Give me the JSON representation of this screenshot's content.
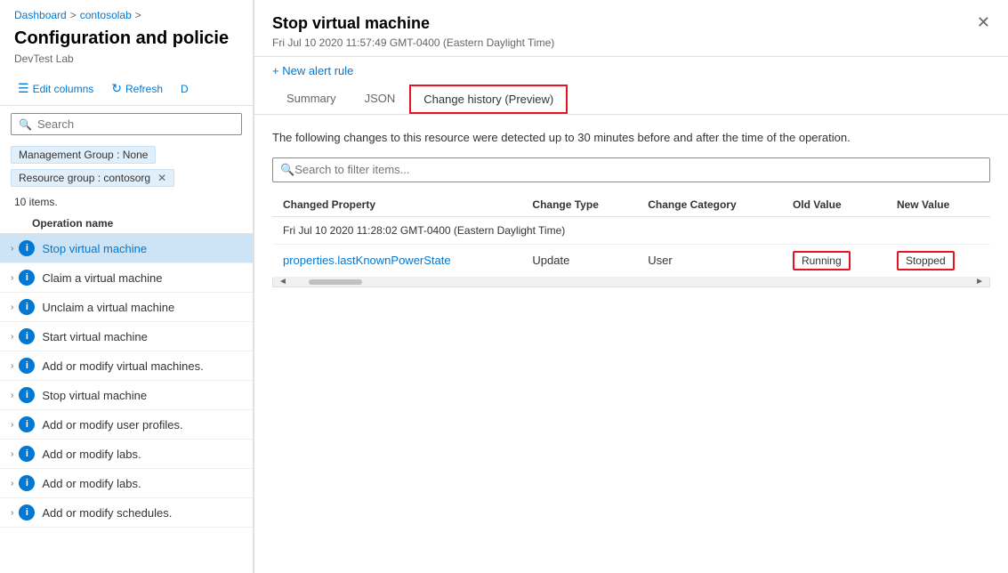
{
  "breadcrumb": {
    "items": [
      "Dashboard",
      "contosolab"
    ],
    "separators": [
      ">",
      ">"
    ]
  },
  "page": {
    "title": "Configuration and policie",
    "subtitle": "DevTest Lab"
  },
  "toolbar": {
    "edit_columns_label": "Edit columns",
    "refresh_label": "Refresh",
    "diagnostics_label": "D"
  },
  "search": {
    "placeholder": "Search"
  },
  "filters": [
    {
      "label": "Management Group : None",
      "removable": false
    },
    {
      "label": "Resource group : contosorg",
      "removable": true
    }
  ],
  "items_count": "10 items.",
  "column_header": "Operation name",
  "list_items": [
    {
      "text": "Stop virtual machine",
      "selected": true
    },
    {
      "text": "Claim a virtual machine",
      "selected": false
    },
    {
      "text": "Unclaim a virtual machine",
      "selected": false
    },
    {
      "text": "Start virtual machine",
      "selected": false
    },
    {
      "text": "Add or modify virtual machines.",
      "selected": false
    },
    {
      "text": "Stop virtual machine",
      "selected": false
    },
    {
      "text": "Add or modify user profiles.",
      "selected": false
    },
    {
      "text": "Add or modify labs.",
      "selected": false
    },
    {
      "text": "Add or modify labs.",
      "selected": false
    },
    {
      "text": "Add or modify schedules.",
      "selected": false
    }
  ],
  "detail": {
    "title": "Stop virtual machine",
    "timestamp": "Fri Jul 10 2020 11:57:49 GMT-0400 (Eastern Daylight Time)",
    "new_alert_rule_label": "+ New alert rule",
    "tabs": [
      {
        "label": "Summary",
        "active": false
      },
      {
        "label": "JSON",
        "active": false
      },
      {
        "label": "Change history (Preview)",
        "active": true,
        "bordered": true
      }
    ],
    "change_description": "The following changes to this resource were detected up to 30 minutes before and after the time of the operation.",
    "filter_placeholder": "Search to filter items...",
    "table": {
      "headers": [
        "Changed Property",
        "Change Type",
        "Change Category",
        "Old Value",
        "New Value"
      ],
      "group_label": "Fri Jul 10 2020 11:28:02 GMT-0400 (Eastern Daylight Time)",
      "rows": [
        {
          "property": "properties.lastKnownPowerState",
          "change_type": "Update",
          "change_category": "User",
          "old_value": "Running",
          "new_value": "Stopped"
        }
      ]
    }
  },
  "icons": {
    "edit": "☰",
    "refresh": "↻",
    "search": "🔍",
    "chevron": "›",
    "info": "i",
    "close": "✕",
    "plus": "+",
    "left_arrow": "◄",
    "right_arrow": "►"
  }
}
